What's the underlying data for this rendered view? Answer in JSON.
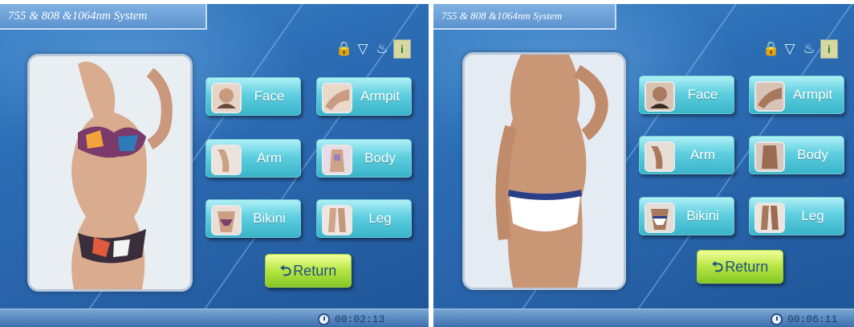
{
  "panels": [
    {
      "title": "755 & 808 &1064nm System",
      "zones": [
        "Face",
        "Armpit",
        "Arm",
        "Body",
        "Bikini",
        "Leg"
      ],
      "return_label": "Return",
      "timer": "00:02:13",
      "status_icons": [
        "lock-icon",
        "cup-icon",
        "faucet-icon",
        "info-icon"
      ]
    },
    {
      "title": "755 & 808 &1064nm System",
      "zones": [
        "Face",
        "Armpit",
        "Arm",
        "Body",
        "Bikini",
        "Leg"
      ],
      "return_label": "Return",
      "timer": "00:06:11",
      "status_icons": [
        "lock-icon",
        "cup-icon",
        "faucet-icon",
        "info-icon"
      ]
    }
  ],
  "colors": {
    "background_blue": "#2b6cb3",
    "zone_button": "#5fcfe0",
    "return_button": "#b5e542"
  }
}
